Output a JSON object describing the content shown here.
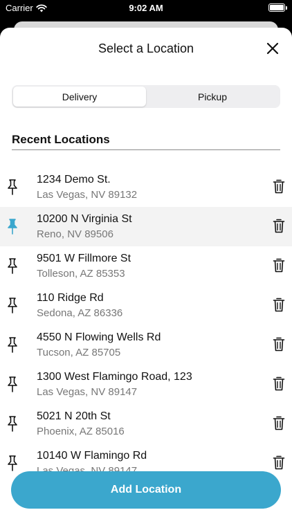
{
  "status_bar": {
    "carrier": "Carrier",
    "time": "9:02 AM",
    "battery_level": 1.0
  },
  "sheet": {
    "title": "Select a Location",
    "close_icon": "close-icon"
  },
  "tabs": [
    {
      "label": "Delivery",
      "active": true
    },
    {
      "label": "Pickup",
      "active": false
    }
  ],
  "section": {
    "heading": "Recent Locations"
  },
  "locations": [
    {
      "street": "1234 Demo St.",
      "city": "Las Vegas, NV 89132",
      "selected": false
    },
    {
      "street": "10200 N Virginia St",
      "city": "Reno, NV 89506",
      "selected": true
    },
    {
      "street": "9501 W Fillmore St",
      "city": "Tolleson, AZ 85353",
      "selected": false
    },
    {
      "street": "110 Ridge Rd",
      "city": "Sedona, AZ 86336",
      "selected": false
    },
    {
      "street": "4550 N Flowing Wells Rd",
      "city": "Tucson, AZ 85705",
      "selected": false
    },
    {
      "street": "1300 West Flamingo Road, 123",
      "city": "Las Vegas, NV 89147",
      "selected": false
    },
    {
      "street": "5021 N 20th St",
      "city": "Phoenix, AZ 85016",
      "selected": false
    },
    {
      "street": "10140 W Flamingo Rd",
      "city": "Las Vegas, NV 89147",
      "selected": false
    }
  ],
  "add_button": {
    "label": "Add Location"
  },
  "colors": {
    "accent": "#3ba7cd",
    "pin_default": "#111111",
    "pin_selected": "#3ba7cd"
  }
}
